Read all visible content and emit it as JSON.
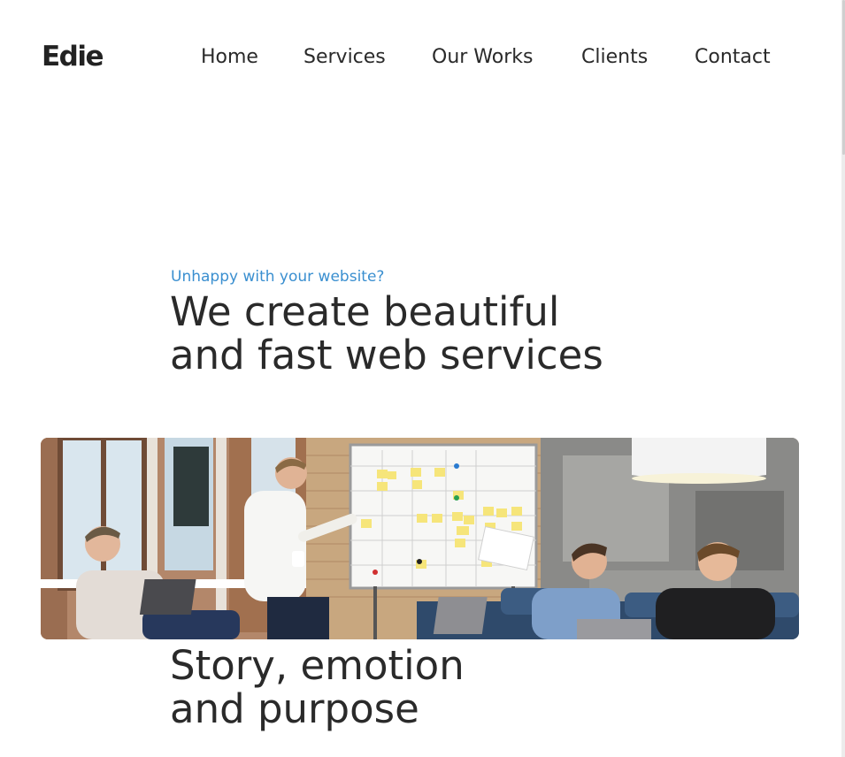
{
  "header": {
    "logo": "Edie",
    "nav": [
      {
        "label": "Home"
      },
      {
        "label": "Services"
      },
      {
        "label": "Our Works"
      },
      {
        "label": "Clients"
      },
      {
        "label": "Contact"
      }
    ]
  },
  "hero": {
    "kicker": "Unhappy with your website?",
    "title_lines": [
      "We create beautiful",
      "and fast web services"
    ],
    "kicker_color": "#3a8fd0"
  },
  "photo": {
    "subject": "team meeting around a whiteboard with sticky notes"
  },
  "story": {
    "title_lines": [
      "Story, emotion",
      "and purpose"
    ]
  }
}
